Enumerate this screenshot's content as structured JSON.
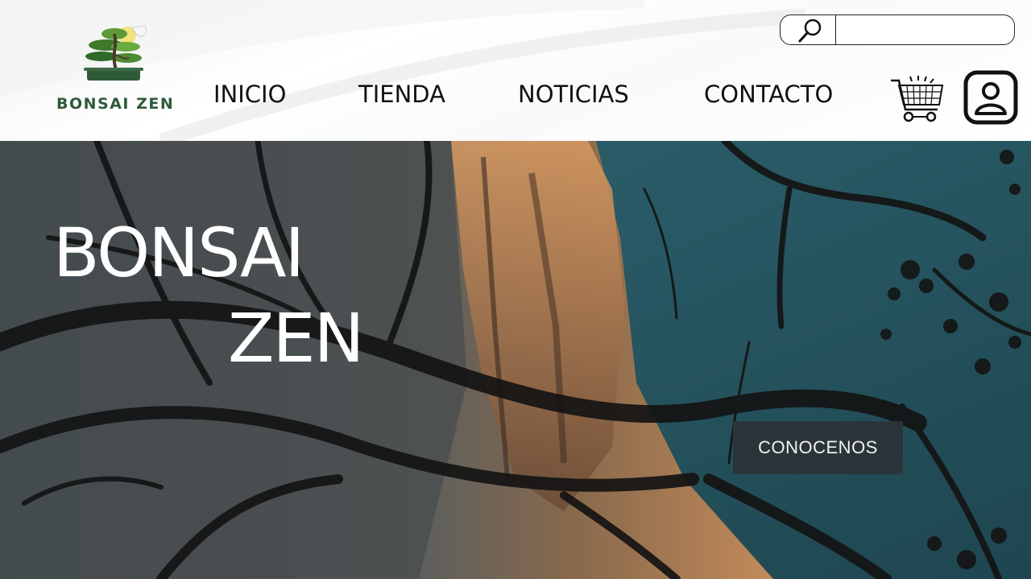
{
  "brand": {
    "name": "BONSAI ZEN",
    "logo_icon": "bonsai-tree-icon",
    "color": "#2f5a3a"
  },
  "nav": {
    "items": [
      {
        "label": "INICIO"
      },
      {
        "label": "TIENDA"
      },
      {
        "label": "NOTICIAS"
      },
      {
        "label": "CONTACTO"
      }
    ]
  },
  "search": {
    "icon": "magnifier-icon",
    "value": "",
    "placeholder": ""
  },
  "header_icons": {
    "cart": "shopping-cart-icon",
    "user": "user-profile-icon"
  },
  "hero": {
    "title_line1": "BONSAI",
    "title_line2": "ZEN",
    "cta_label": "CONOCENOS",
    "cta_color": "#2a3439",
    "sky_color": "#2c5a66"
  }
}
